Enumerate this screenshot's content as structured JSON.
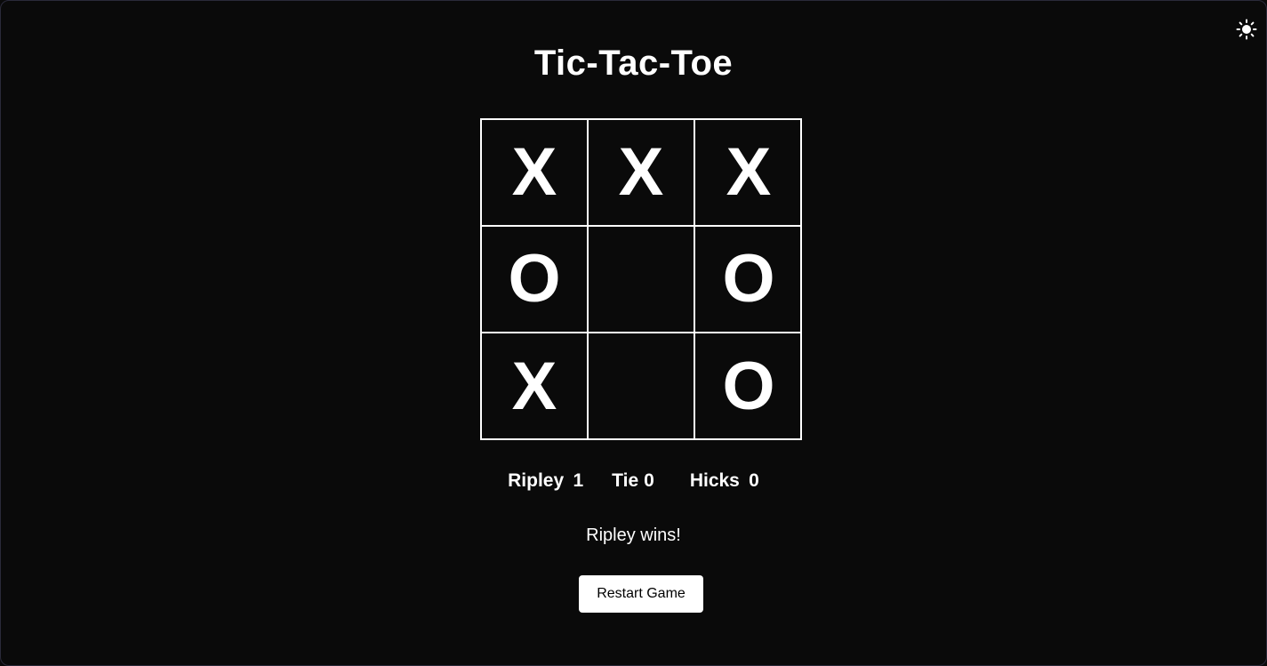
{
  "header": {
    "title": "Tic-Tac-Toe",
    "theme_toggle_icon": "sun-icon"
  },
  "board": {
    "cells": [
      "X",
      "X",
      "X",
      "O",
      "",
      "O",
      "X",
      "",
      "O"
    ]
  },
  "scores": {
    "player1": {
      "name": "Ripley",
      "value": "1"
    },
    "tie": {
      "name": "Tie",
      "value": "0"
    },
    "player2": {
      "name": "Hicks",
      "value": "0"
    }
  },
  "status": {
    "message": "Ripley wins!"
  },
  "controls": {
    "restart_label": "Restart Game"
  },
  "colors": {
    "background": "#0a0a0a",
    "foreground": "#ffffff",
    "button_text": "#000000"
  }
}
